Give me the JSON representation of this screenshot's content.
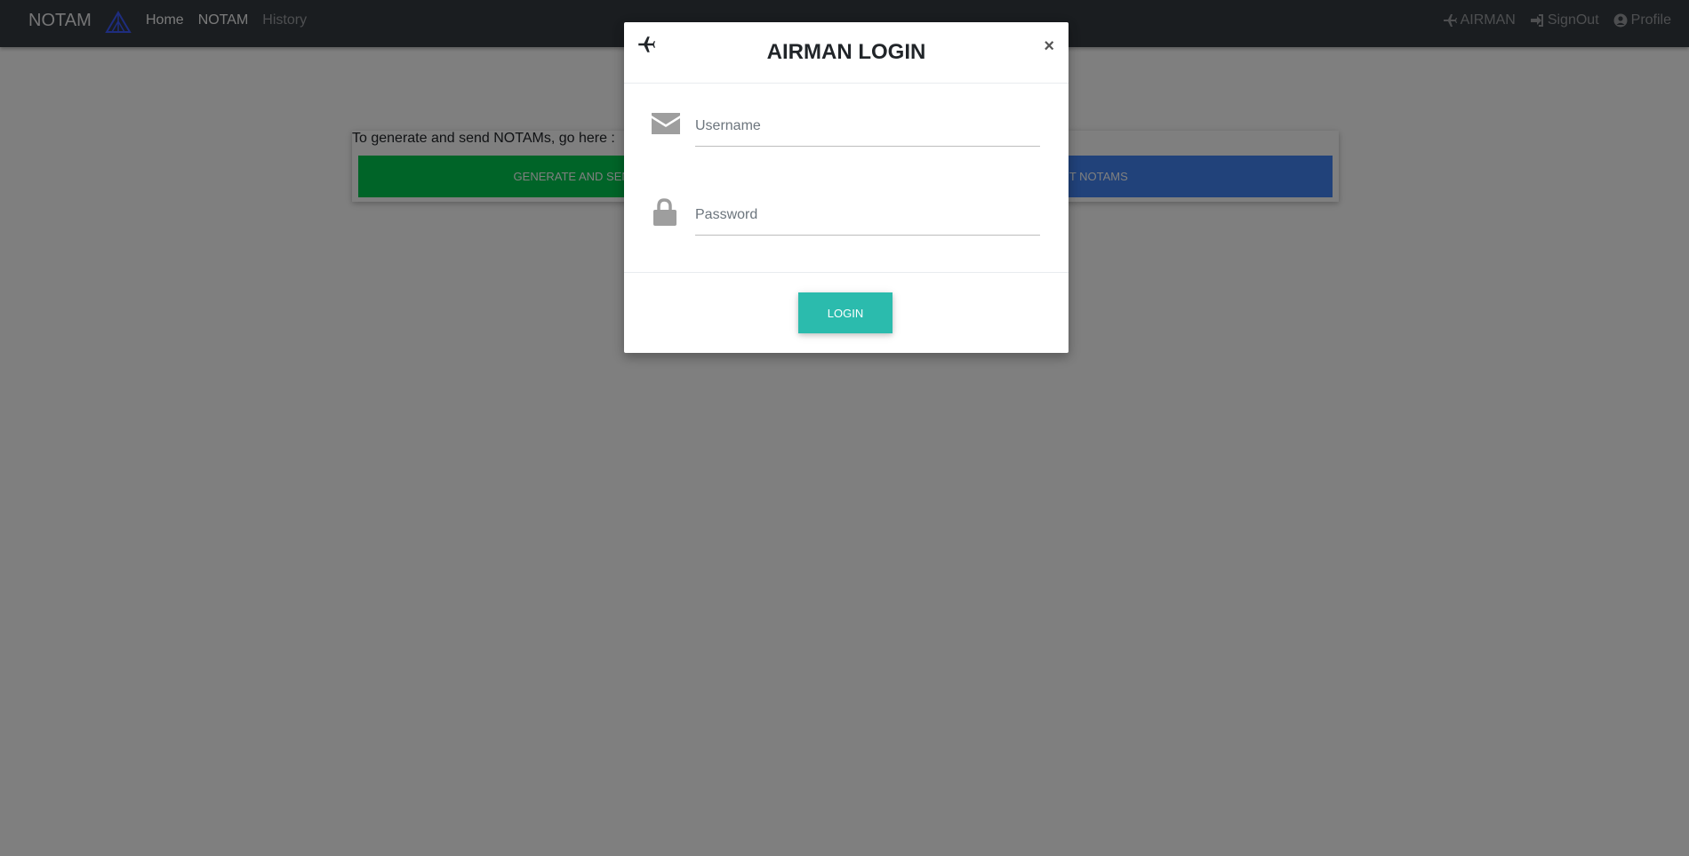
{
  "navbar": {
    "brand": "NOTAM",
    "links": [
      "Home",
      "NOTAM",
      "History"
    ],
    "right": {
      "airman": "AIRMAN",
      "signout": "SignOut",
      "profile": "Profile"
    }
  },
  "main": {
    "intro_text": "To generate and send NOTAMs, go here :",
    "generate_button": "GENERATE AND SEND NOTAMS",
    "edit_button": "EDIT NOTAMS"
  },
  "modal": {
    "title": "AIRMAN LOGIN",
    "close": "×",
    "username_placeholder": "Username",
    "password_placeholder": "Password",
    "login_button": "LOGIN"
  },
  "colors": {
    "navbar": "#343a40",
    "generate": "#00c851",
    "edit": "#4285f4",
    "login": "#2bbbad"
  }
}
